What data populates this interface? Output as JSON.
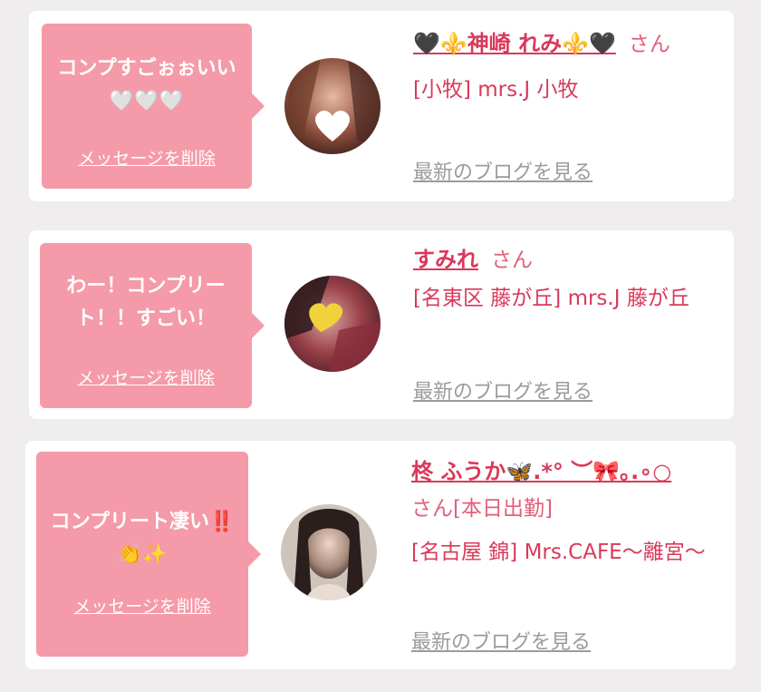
{
  "colors": {
    "background": "#efeded",
    "bubble": "#f59aa8",
    "accent": "#d9395a",
    "link_gray": "#9b9b9b"
  },
  "delete_label": "メッセージを削除",
  "honorific": "さん",
  "blog_label": "最新のブログを見る",
  "cards": [
    {
      "message": "コンプすごぉぉいい🤍🤍🤍",
      "name": "🖤⚜️神崎 れみ⚜️🖤",
      "status": "",
      "shop": "[小牧] mrs.J 小牧",
      "avatar_icon": "blurred-face-photo-heart-sticker"
    },
    {
      "message": "わー！コンプリート！！すごい！",
      "name": "すみれ",
      "status": "",
      "shop": "[名東区 藤が丘] mrs.J 藤が丘",
      "avatar_icon": "blurred-face-photo-heart-sticker"
    },
    {
      "message": "コンプリート凄い‼️👏✨",
      "name": "柊 ふうか🦋.*° ︶🎀｡.∘○",
      "status": "[本日出勤]",
      "shop": "[名古屋 錦] Mrs.CAFE～離宮～",
      "avatar_icon": "portrait-photo"
    }
  ]
}
